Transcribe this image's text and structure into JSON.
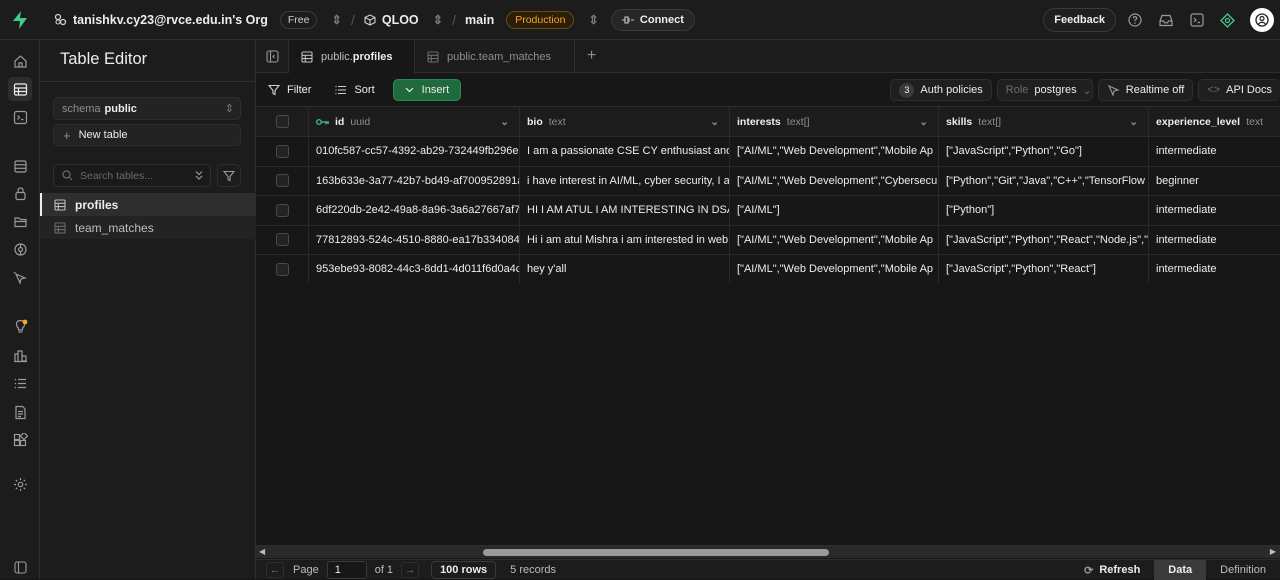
{
  "topbar": {
    "org": "tanishkv.cy23@rvce.edu.in's Org",
    "plan": "Free",
    "project": "QLOO",
    "branch": "main",
    "env": "Production",
    "connect": "Connect",
    "feedback": "Feedback"
  },
  "sidebar": {
    "title": "Table Editor",
    "schema_label": "schema",
    "schema_value": "public",
    "new_table": "New table",
    "search_placeholder": "Search tables...",
    "tables": [
      {
        "label": "profiles",
        "active": true
      },
      {
        "label": "team_matches",
        "active": false
      }
    ]
  },
  "tabs": [
    {
      "schema": "public.",
      "name": "profiles",
      "active": true
    },
    {
      "schema": "public.",
      "name": "team_matches",
      "active": false
    }
  ],
  "toolbar": {
    "filter": "Filter",
    "sort": "Sort",
    "insert": "Insert",
    "auth_count": "3",
    "auth_policies": "Auth policies",
    "role_label": "Role",
    "role_value": "postgres",
    "realtime": "Realtime off",
    "api_docs": "API Docs"
  },
  "table": {
    "columns": [
      {
        "name": "id",
        "type": "uuid"
      },
      {
        "name": "bio",
        "type": "text"
      },
      {
        "name": "interests",
        "type": "text[]"
      },
      {
        "name": "skills",
        "type": "text[]"
      },
      {
        "name": "experience_level",
        "type": "text"
      }
    ],
    "rows": [
      [
        "010fc587-cc57-4392-ab29-732449fb296e",
        "I am a passionate CSE CY enthusiast and",
        "[\"AI/ML\",\"Web Development\",\"Mobile Ap",
        "[\"JavaScript\",\"Python\",\"Go\"]",
        "intermediate"
      ],
      [
        "163b633e-3a77-42b7-bd49-af700952891a",
        "i have interest in AI/ML, cyber security, I a",
        "[\"AI/ML\",\"Web Development\",\"Cybersecu",
        "[\"Python\",\"Git\",\"Java\",\"C++\",\"TensorFlow",
        "beginner"
      ],
      [
        "6df220db-2e42-49a8-8a96-3a6a27667af7",
        "HI I AM ATUL I AM INTERESTING IN DSA",
        "[\"AI/ML\"]",
        "[\"Python\"]",
        "intermediate"
      ],
      [
        "77812893-524c-4510-8880-ea17b334084a",
        "Hi i am atul Mishra i am interested in web",
        "[\"AI/ML\",\"Web Development\",\"Mobile Ap",
        "[\"JavaScript\",\"Python\",\"React\",\"Node.js\",\"",
        "intermediate"
      ],
      [
        "953ebe93-8082-44c3-8dd1-4d011f6d0a4c",
        "hey y'all",
        "[\"AI/ML\",\"Web Development\",\"Mobile Ap",
        "[\"JavaScript\",\"Python\",\"React\"]",
        "intermediate"
      ]
    ]
  },
  "footer": {
    "page_label": "Page",
    "page_value": "1",
    "of_pages": "of 1",
    "rows_per_page": "100 rows",
    "records": "5 records",
    "refresh": "Refresh",
    "data_tab": "Data",
    "definition_tab": "Definition"
  },
  "colors": {
    "accent": "#3ecf8e",
    "insert_bg": "#1f6b3d",
    "production": "#f5a623"
  }
}
